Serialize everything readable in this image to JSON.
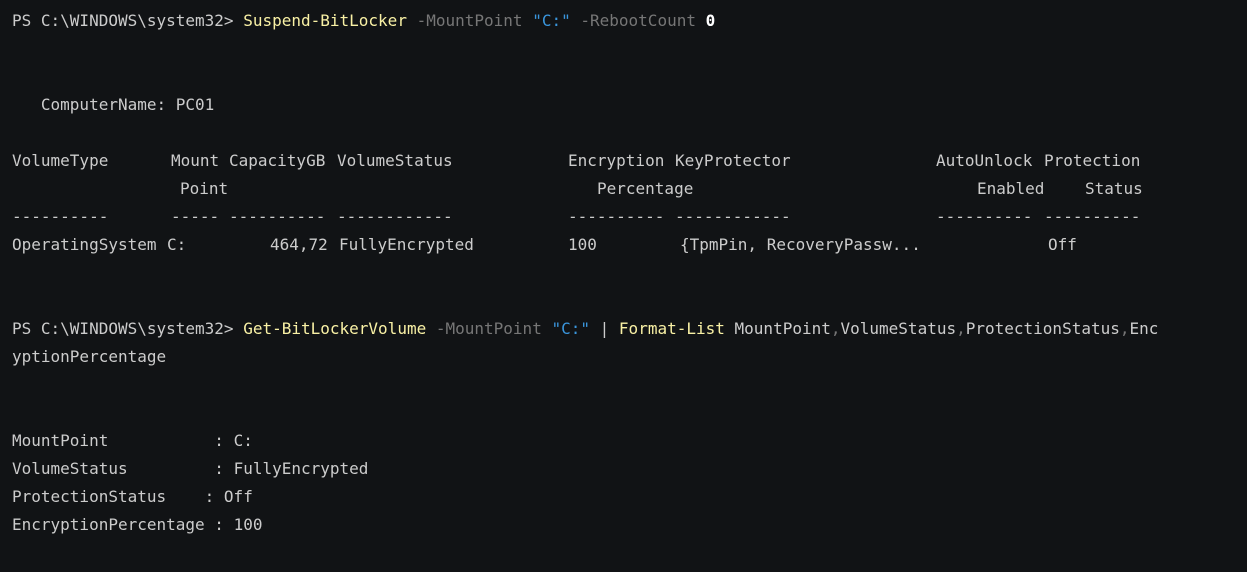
{
  "prompt": "PS C:\\WINDOWS\\system32> ",
  "cmd1": {
    "cmdlet": "Suspend-BitLocker",
    "p1": "-MountPoint",
    "v1": "\"C:\"",
    "p2": "-RebootCount",
    "v2": "0"
  },
  "computer_name_line": "   ComputerName: PC01",
  "table": {
    "headers_line1": {
      "volume_type": "VolumeType",
      "mount": "Mount",
      "capacity": "CapacityGB",
      "volume_status": "VolumeStatus",
      "encryption": "Encryption",
      "key_protector": "KeyProtector",
      "auto_unlock": "AutoUnlock",
      "protection": "Protection"
    },
    "headers_line2": {
      "mount": "Point",
      "encryption": "Percentage",
      "auto_unlock": "Enabled",
      "protection": "Status"
    },
    "dashes": {
      "volume_type": "----------",
      "mount": "-----",
      "capacity": "----------",
      "volume_status": "------------",
      "encryption": "----------",
      "key_protector": "------------",
      "auto_unlock": "----------",
      "protection": "----------"
    },
    "row": {
      "volume_type": "OperatingSystem",
      "mount": "C:",
      "capacity": "464,72",
      "volume_status": "FullyEncrypted",
      "encryption": "100",
      "key_protector": "{TpmPin, RecoveryPassw...",
      "protection": "Off"
    }
  },
  "cmd2": {
    "cmdlet": "Get-BitLockerVolume",
    "p1": "-MountPoint",
    "v1": "\"C:\"",
    "pipe": "|",
    "cmdlet2": "Format-List",
    "a1": "MountPoint",
    "a2": "VolumeStatus",
    "a3": "ProtectionStatus",
    "a4": "Enc",
    "wrap": "yptionPercentage",
    "comma": ","
  },
  "list": [
    {
      "key": "MountPoint           ",
      "sep": ": ",
      "value": "C:"
    },
    {
      "key": "VolumeStatus         ",
      "sep": ": ",
      "value": "FullyEncrypted"
    },
    {
      "key": "ProtectionStatus    ",
      "sep": ": ",
      "value": "Off"
    },
    {
      "key": "EncryptionPercentage ",
      "sep": ": ",
      "value": "100"
    }
  ]
}
